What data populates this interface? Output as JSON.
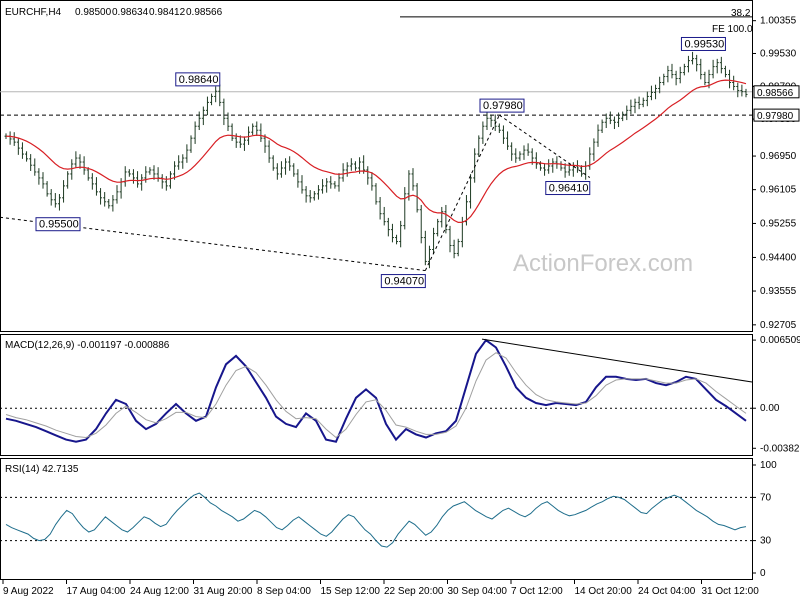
{
  "chart_data": [
    {
      "id": "price",
      "type": "ohlc",
      "title": "EURCHF,H4",
      "ohlc_header": [
        "0.98500",
        "0.98634",
        "0.98412",
        "0.98566"
      ],
      "ylim": [
        0.9255,
        1.0085
      ],
      "y_ticks": [
        "1.00355",
        "0.99530",
        "0.98700",
        "0.97880",
        "0.96950",
        "0.96105",
        "0.95255",
        "0.94400",
        "0.93555",
        "0.92705"
      ],
      "current_price": "0.98566",
      "support_level": "0.97980",
      "fib_labels": {
        "top": "38.2",
        "fe": "FE 100.0"
      },
      "fe_level": 1.0045,
      "annotations": [
        {
          "label": "0.95500",
          "x_index": 18,
          "value": 0.955
        },
        {
          "label": "0.98640",
          "x_index": 52,
          "value": 0.9864
        },
        {
          "label": "0.94070",
          "x_index": 102,
          "value": 0.9407
        },
        {
          "label": "0.97980",
          "x_index": 126,
          "value": 0.9798
        },
        {
          "label": "0.96410",
          "x_index": 142,
          "value": 0.9641
        },
        {
          "label": "0.99530",
          "x_index": 175,
          "value": 0.9953
        }
      ],
      "close_series": [
        0.9745,
        0.9738,
        0.973,
        0.9715,
        0.97,
        0.9688,
        0.9672,
        0.9655,
        0.964,
        0.9625,
        0.96,
        0.9585,
        0.9575,
        0.959,
        0.962,
        0.965,
        0.9675,
        0.969,
        0.968,
        0.966,
        0.964,
        0.9625,
        0.9605,
        0.959,
        0.958,
        0.957,
        0.9585,
        0.9605,
        0.963,
        0.9655,
        0.965,
        0.964,
        0.9625,
        0.964,
        0.9655,
        0.966,
        0.965,
        0.964,
        0.963,
        0.962,
        0.965,
        0.967,
        0.968,
        0.969,
        0.971,
        0.974,
        0.977,
        0.979,
        0.981,
        0.983,
        0.9845,
        0.9858,
        0.983,
        0.979,
        0.977,
        0.974,
        0.973,
        0.9725,
        0.9735,
        0.9755,
        0.977,
        0.976,
        0.974,
        0.972,
        0.969,
        0.9665,
        0.965,
        0.9665,
        0.968,
        0.967,
        0.965,
        0.963,
        0.961,
        0.9595,
        0.959,
        0.96,
        0.961,
        0.962,
        0.963,
        0.9625,
        0.962,
        0.964,
        0.966,
        0.967,
        0.9675,
        0.9665,
        0.968,
        0.966,
        0.964,
        0.962,
        0.958,
        0.955,
        0.953,
        0.951,
        0.949,
        0.948,
        0.952,
        0.96,
        0.965,
        0.962,
        0.956,
        0.949,
        0.943,
        0.946,
        0.95,
        0.953,
        0.9555,
        0.951,
        0.947,
        0.945,
        0.948,
        0.953,
        0.958,
        0.964,
        0.97,
        0.974,
        0.977,
        0.979,
        0.9785,
        0.977,
        0.976,
        0.974,
        0.972,
        0.97,
        0.969,
        0.97,
        0.971,
        0.9705,
        0.969,
        0.9675,
        0.9665,
        0.966,
        0.967,
        0.968,
        0.9675,
        0.9665,
        0.9655,
        0.966,
        0.967,
        0.9665,
        0.965,
        0.967,
        0.97,
        0.973,
        0.976,
        0.978,
        0.979,
        0.9785,
        0.978,
        0.979,
        0.98,
        0.981,
        0.982,
        0.983,
        0.9825,
        0.9835,
        0.9845,
        0.9855,
        0.9865,
        0.988,
        0.9895,
        0.991,
        0.99,
        0.989,
        0.9905,
        0.992,
        0.9935,
        0.994,
        0.9925,
        0.99,
        0.988,
        0.99,
        0.992,
        0.993,
        0.9915,
        0.99,
        0.988,
        0.987,
        0.986,
        0.9857,
        0.985
      ]
    },
    {
      "id": "macd",
      "type": "line",
      "title": "MACD(12,26,9) -0.001197 -0.000886",
      "ylim": [
        -0.00447,
        0.0069
      ],
      "y_ticks": [
        {
          "label": "0.006509",
          "value": 0.006509
        },
        {
          "label": "0.00",
          "value": 0.0
        },
        {
          "label": "-0.003828",
          "value": -0.003828
        }
      ],
      "zero_label": "0.00",
      "series": [
        {
          "role": "macd",
          "values": [
            -0.001,
            -0.0012,
            -0.0015,
            -0.0018,
            -0.0022,
            -0.0026,
            -0.003,
            -0.0032,
            -0.003,
            -0.002,
            -0.0005,
            0.0008,
            0.0004,
            -0.0012,
            -0.002,
            -0.0015,
            -0.0005,
            0.0004,
            -0.0005,
            -0.0012,
            -0.0008,
            0.002,
            0.0042,
            0.005,
            0.004,
            0.0025,
            0.001,
            -0.0008,
            -0.0015,
            -0.0018,
            -0.0005,
            -0.0012,
            -0.003,
            -0.0032,
            -0.001,
            0.001,
            0.0018,
            0.001,
            -0.0015,
            -0.003,
            -0.002,
            -0.0025,
            -0.0028,
            -0.0024,
            -0.0022,
            -0.0012,
            0.002,
            0.0052,
            0.0065,
            0.0058,
            0.004,
            0.002,
            0.001,
            0.0005,
            0.0003,
            0.0005,
            0.0004,
            0.0003,
            0.0006,
            0.002,
            0.003,
            0.003,
            0.0028,
            0.0027,
            0.0028,
            0.0024,
            0.0022,
            0.0025,
            0.003,
            0.0028,
            0.0018,
            0.0008,
            0.0002,
            -0.0005,
            -0.0012
          ]
        },
        {
          "role": "signal",
          "values": [
            -0.0006,
            -0.0009,
            -0.0011,
            -0.0014,
            -0.0017,
            -0.0021,
            -0.0024,
            -0.0027,
            -0.0028,
            -0.0024,
            -0.0016,
            -0.0005,
            0.0002,
            -0.0004,
            -0.0011,
            -0.0014,
            -0.001,
            -0.0004,
            -0.0004,
            -0.0008,
            -0.0009,
            0.0004,
            0.0022,
            0.0036,
            0.004,
            0.0034,
            0.0022,
            0.0008,
            -0.0003,
            -0.001,
            -0.0009,
            -0.001,
            -0.002,
            -0.0028,
            -0.002,
            -0.0006,
            0.0006,
            0.0008,
            -0.0002,
            -0.0016,
            -0.0018,
            -0.0022,
            -0.0025,
            -0.0025,
            -0.0023,
            -0.0017,
            0.0,
            0.0026,
            0.0046,
            0.0053,
            0.0048,
            0.0034,
            0.0022,
            0.0013,
            0.0008,
            0.0006,
            0.0005,
            0.0004,
            0.0005,
            0.0012,
            0.0022,
            0.0027,
            0.0028,
            0.0028,
            0.0028,
            0.0026,
            0.0024,
            0.0024,
            0.0027,
            0.0028,
            0.0024,
            0.0016,
            0.0009,
            0.0002,
            -0.0005
          ]
        }
      ],
      "trendline": [
        [
          0.0066,
          0.0025
        ]
      ]
    },
    {
      "id": "rsi",
      "type": "line",
      "title": "RSI(14) 42.7135",
      "ylim": [
        0,
        100
      ],
      "y_ticks": [
        {
          "label": "100",
          "value": 100
        },
        {
          "label": "70",
          "value": 70
        },
        {
          "label": "30",
          "value": 30
        },
        {
          "label": "0",
          "value": 0
        }
      ],
      "levels": [
        70,
        30
      ],
      "values": [
        45,
        42,
        40,
        38,
        36,
        32,
        30,
        31,
        36,
        45,
        52,
        58,
        55,
        48,
        42,
        38,
        40,
        46,
        52,
        48,
        44,
        40,
        38,
        42,
        47,
        52,
        50,
        46,
        43,
        45,
        52,
        58,
        63,
        68,
        72,
        74,
        70,
        65,
        62,
        58,
        55,
        52,
        48,
        50,
        54,
        58,
        56,
        52,
        47,
        42,
        40,
        44,
        49,
        52,
        48,
        44,
        40,
        36,
        34,
        38,
        44,
        50,
        54,
        52,
        46,
        40,
        36,
        30,
        25,
        24,
        28,
        36,
        42,
        48,
        45,
        40,
        35,
        38,
        44,
        52,
        58,
        62,
        64,
        66,
        62,
        58,
        55,
        52,
        50,
        54,
        58,
        60,
        57,
        54,
        52,
        55,
        60,
        64,
        66,
        62,
        58,
        55,
        53,
        54,
        56,
        58,
        61,
        64,
        66,
        69,
        71,
        70,
        68,
        64,
        60,
        56,
        55,
        60,
        64,
        68,
        70,
        72,
        70,
        66,
        62,
        58,
        55,
        52,
        48,
        45,
        44,
        42,
        40,
        42,
        43
      ]
    }
  ],
  "x_axis": {
    "labels": [
      "9 Aug 2022",
      "17 Aug 04:00",
      "24 Aug 12:00",
      "31 Aug 20:00",
      "8 Sep 04:00",
      "15 Sep 12:00",
      "22 Sep 20:00",
      "30 Sep 04:00",
      "7 Oct 12:00",
      "14 Oct 20:00",
      "24 Oct 04:00",
      "31 Oct 12:00"
    ]
  },
  "watermark": "ActionForex.com",
  "colors": {
    "bars": "#1d3a22",
    "ema": "#d81f24",
    "macd": "#17168c",
    "signal": "#a0a0a0",
    "frame": "#000000",
    "grid_dash": "#000000"
  }
}
